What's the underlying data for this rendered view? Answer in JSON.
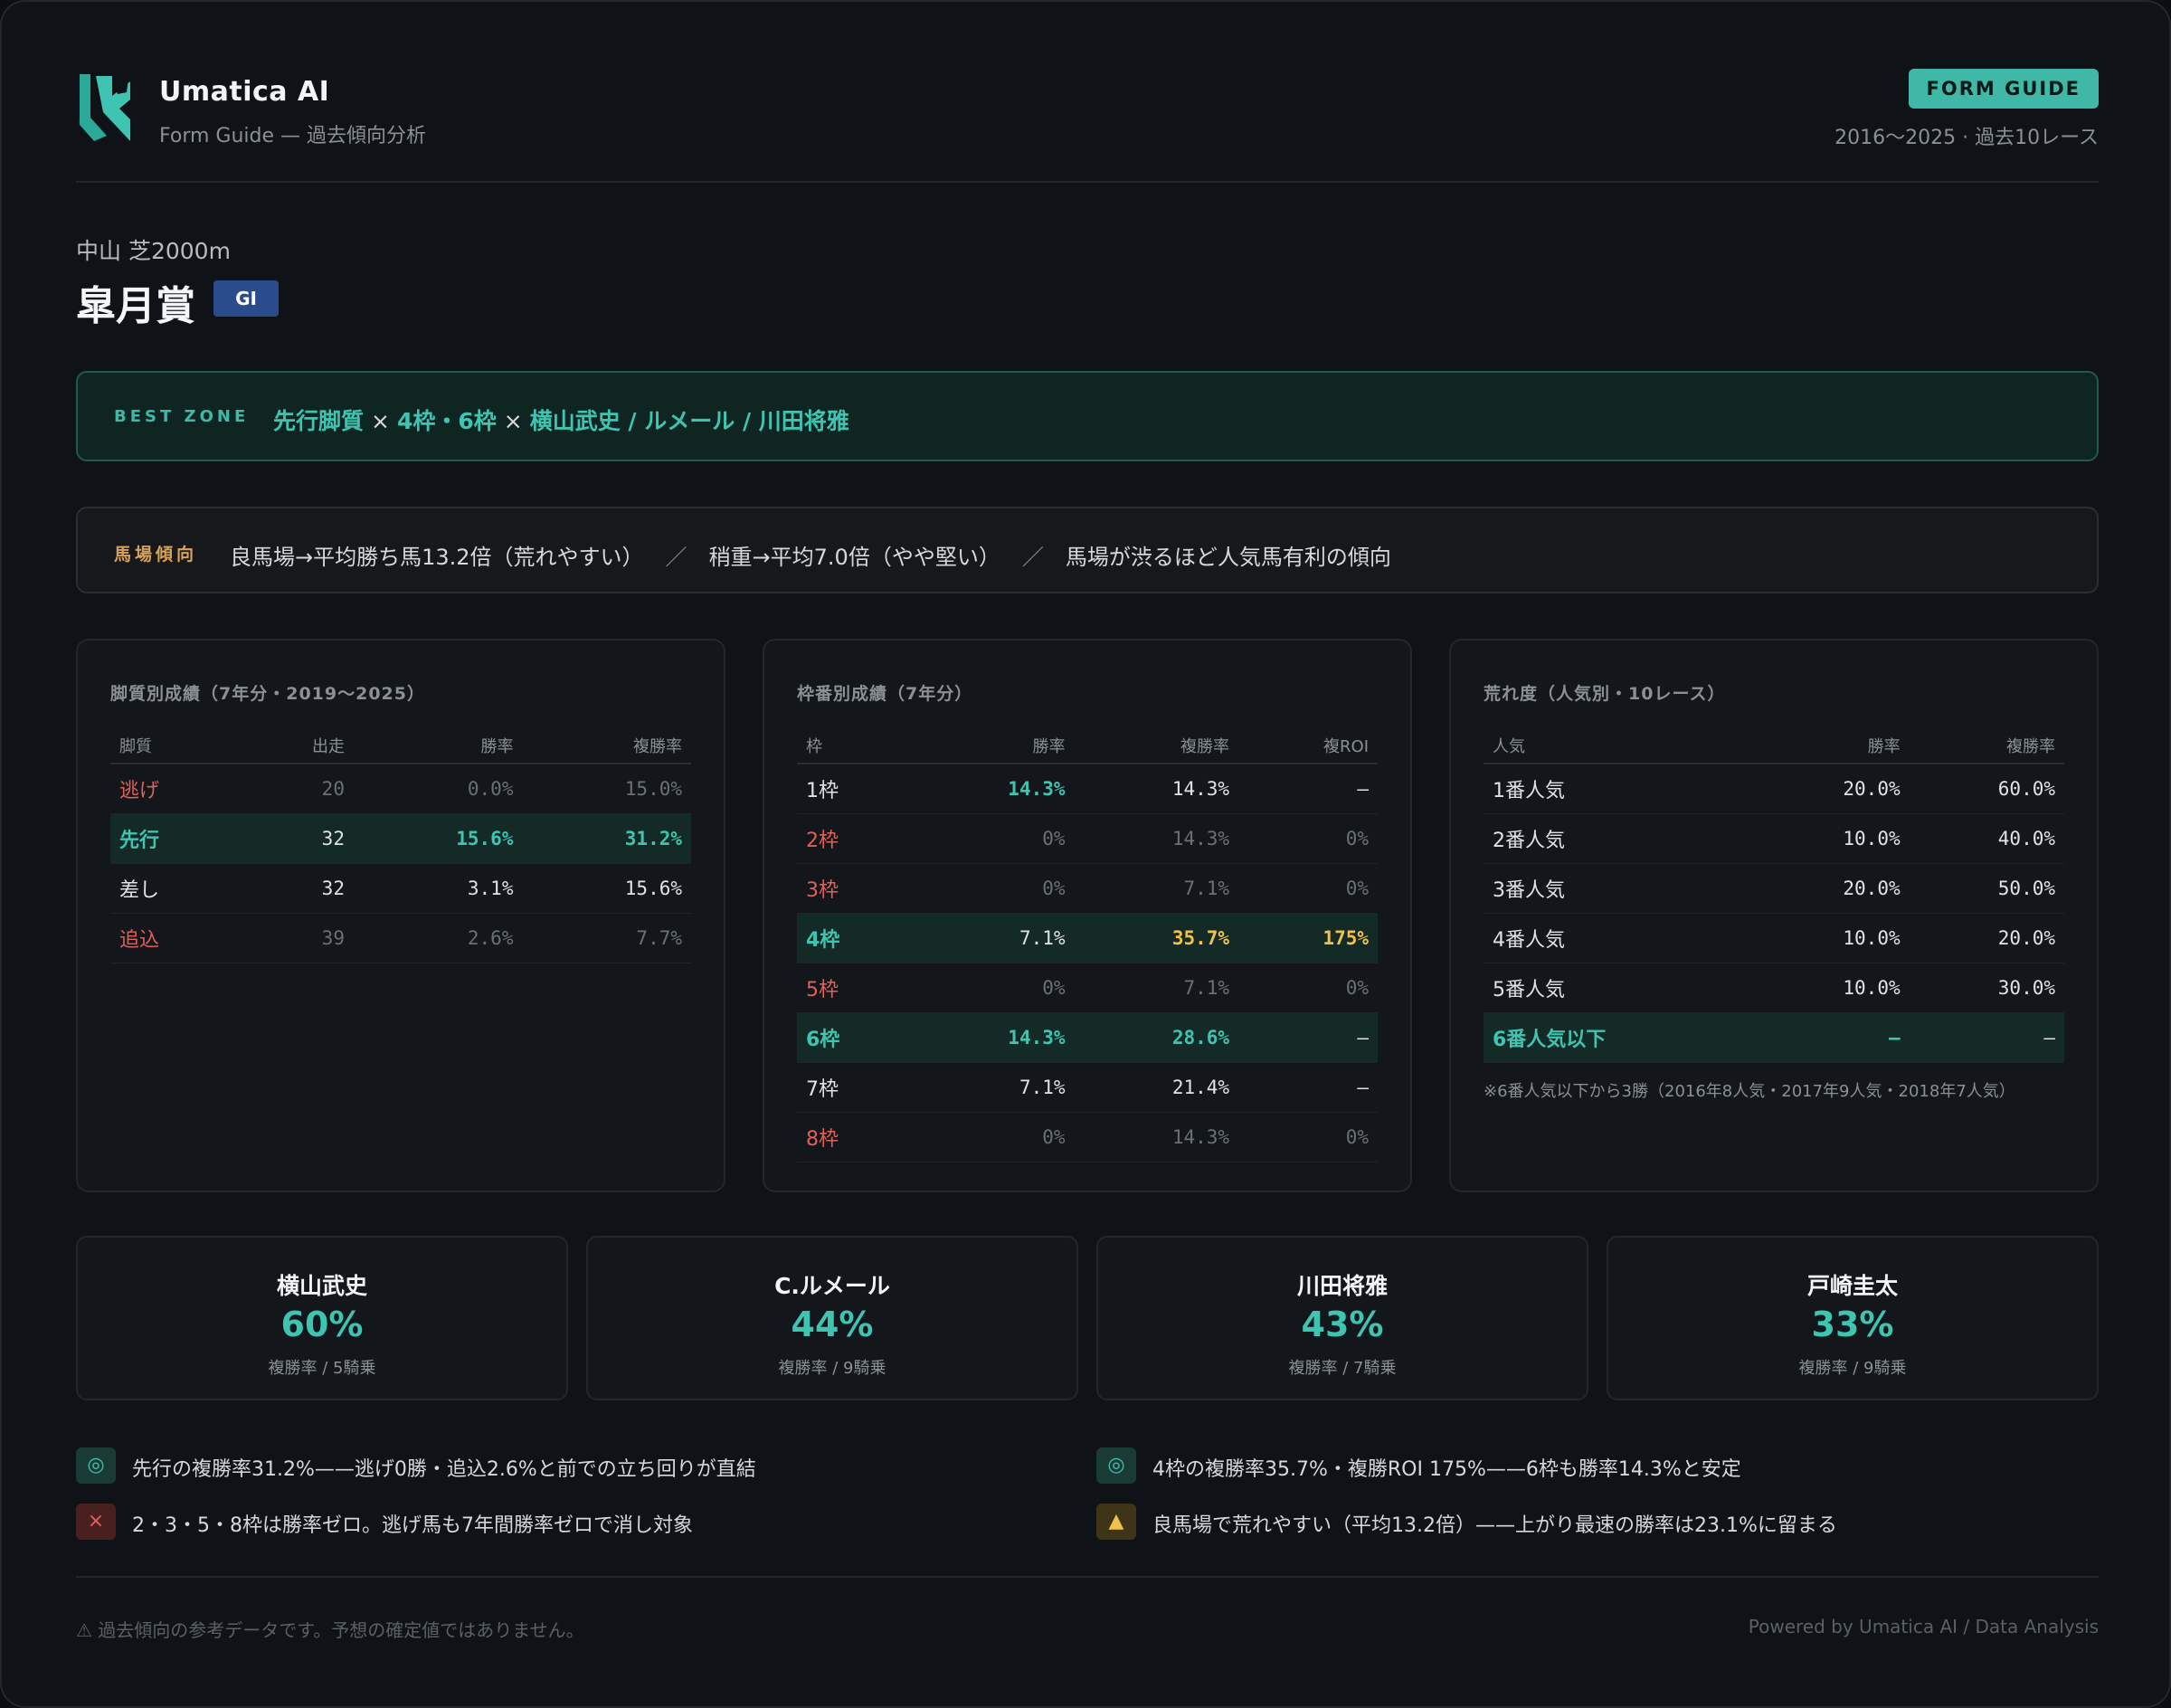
{
  "brand": {
    "name": "Umatica AI",
    "subtitle": "Form Guide — 過去傾向分析"
  },
  "header": {
    "badge": "FORM GUIDE",
    "range": "2016〜2025 · 過去10レース"
  },
  "race": {
    "course": "中山 芝2000m",
    "title": "皐月賞",
    "grade": "GI"
  },
  "best_zone": {
    "label": "BEST ZONE",
    "part1": "先行脚質",
    "sep": "×",
    "part2": "4枠・6枠",
    "part3": "横山武史 / ルメール / 川田将雅"
  },
  "track": {
    "label": "馬場傾向",
    "item1": "良馬場→平均勝ち馬13.2倍（荒れやすい）",
    "sep": "／",
    "item2": "稍重→平均7.0倍（やや堅い）",
    "item3": "馬場が渋るほど人気馬有利の傾向"
  },
  "style_panel": {
    "title": "脚質別成績（7年分・2019〜2025）",
    "headers": [
      "脚質",
      "出走",
      "勝率",
      "複勝率"
    ],
    "rows": [
      [
        "逃げ",
        "20",
        "0.0%",
        "15.0%"
      ],
      [
        "先行",
        "32",
        "15.6%",
        "31.2%"
      ],
      [
        "差し",
        "32",
        "3.1%",
        "15.6%"
      ],
      [
        "追込",
        "39",
        "2.6%",
        "7.7%"
      ]
    ]
  },
  "gate_panel": {
    "title": "枠番別成績（7年分）",
    "headers": [
      "枠",
      "勝率",
      "複勝率",
      "複ROI"
    ],
    "rows": [
      [
        "1枠",
        "14.3%",
        "14.3%",
        "–"
      ],
      [
        "2枠",
        "0%",
        "14.3%",
        "0%"
      ],
      [
        "3枠",
        "0%",
        "7.1%",
        "0%"
      ],
      [
        "4枠",
        "7.1%",
        "35.7%",
        "175%"
      ],
      [
        "5枠",
        "0%",
        "7.1%",
        "0%"
      ],
      [
        "6枠",
        "14.3%",
        "28.6%",
        "–"
      ],
      [
        "7枠",
        "7.1%",
        "21.4%",
        "–"
      ],
      [
        "8枠",
        "0%",
        "14.3%",
        "0%"
      ]
    ]
  },
  "pop_panel": {
    "title": "荒れ度（人気別・10レース）",
    "headers": [
      "人気",
      "勝率",
      "複勝率"
    ],
    "rows": [
      [
        "1番人気",
        "20.0%",
        "60.0%"
      ],
      [
        "2番人気",
        "10.0%",
        "40.0%"
      ],
      [
        "3番人気",
        "20.0%",
        "50.0%"
      ],
      [
        "4番人気",
        "10.0%",
        "20.0%"
      ],
      [
        "5番人気",
        "10.0%",
        "30.0%"
      ],
      [
        "6番人気以下",
        "–",
        "–"
      ]
    ],
    "note": "※6番人気以下から3勝（2016年8人気・2017年9人気・2018年7人気）"
  },
  "jockeys": [
    {
      "name": "横山武史",
      "pct": "60%",
      "sub": "複勝率 / 5騎乗"
    },
    {
      "name": "C.ルメール",
      "pct": "44%",
      "sub": "複勝率 / 9騎乗"
    },
    {
      "name": "川田将雅",
      "pct": "43%",
      "sub": "複勝率 / 7騎乗"
    },
    {
      "name": "戸崎圭太",
      "pct": "33%",
      "sub": "複勝率 / 9騎乗"
    }
  ],
  "insights": [
    {
      "icon": "◎",
      "text": "先行の複勝率31.2%——逃げ0勝・追込2.6%と前での立ち回りが直結"
    },
    {
      "icon": "◎",
      "text": "4枠の複勝率35.7%・複勝ROI 175%——6枠も勝率14.3%と安定"
    },
    {
      "icon": "×",
      "text": "2・3・5・8枠は勝率ゼロ。逃げ馬も7年間勝率ゼロで消し対象"
    },
    {
      "icon": "▲",
      "text": "良馬場で荒れやすい（平均13.2倍）——上がり最速の勝率は23.1%に留まる"
    }
  ],
  "footer": {
    "disclaimer": "⚠ 過去傾向の参考データです。予想の確定値ではありません。",
    "powered": "Powered by Umatica AI / Data Analysis"
  },
  "colors": {
    "accent": "#3fc4b2",
    "warn": "#f0c24a",
    "bad": "#e0605a",
    "track": "#d9a35b",
    "grade": "#2b4c8c"
  }
}
